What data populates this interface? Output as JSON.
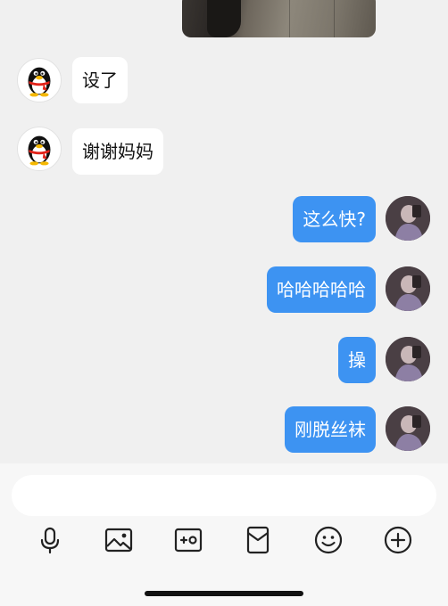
{
  "messages": [
    {
      "direction": "in",
      "sender": "qq",
      "text": "设了"
    },
    {
      "direction": "in",
      "sender": "qq",
      "text": "谢谢妈妈"
    },
    {
      "direction": "out",
      "sender": "me",
      "text": "这么快?"
    },
    {
      "direction": "out",
      "sender": "me",
      "text": "哈哈哈哈哈"
    },
    {
      "direction": "out",
      "sender": "me",
      "text": "操"
    },
    {
      "direction": "out",
      "sender": "me",
      "text": "刚脱丝袜"
    }
  ],
  "input": {
    "value": "",
    "placeholder": ""
  },
  "toolbar": [
    "microphone-icon",
    "image-icon",
    "camera-icon",
    "red-packet-icon",
    "emoji-icon",
    "plus-icon"
  ],
  "colors": {
    "outgoing_bubble": "#3d93f2",
    "incoming_bubble": "#ffffff",
    "background": "#f0f0f0"
  }
}
